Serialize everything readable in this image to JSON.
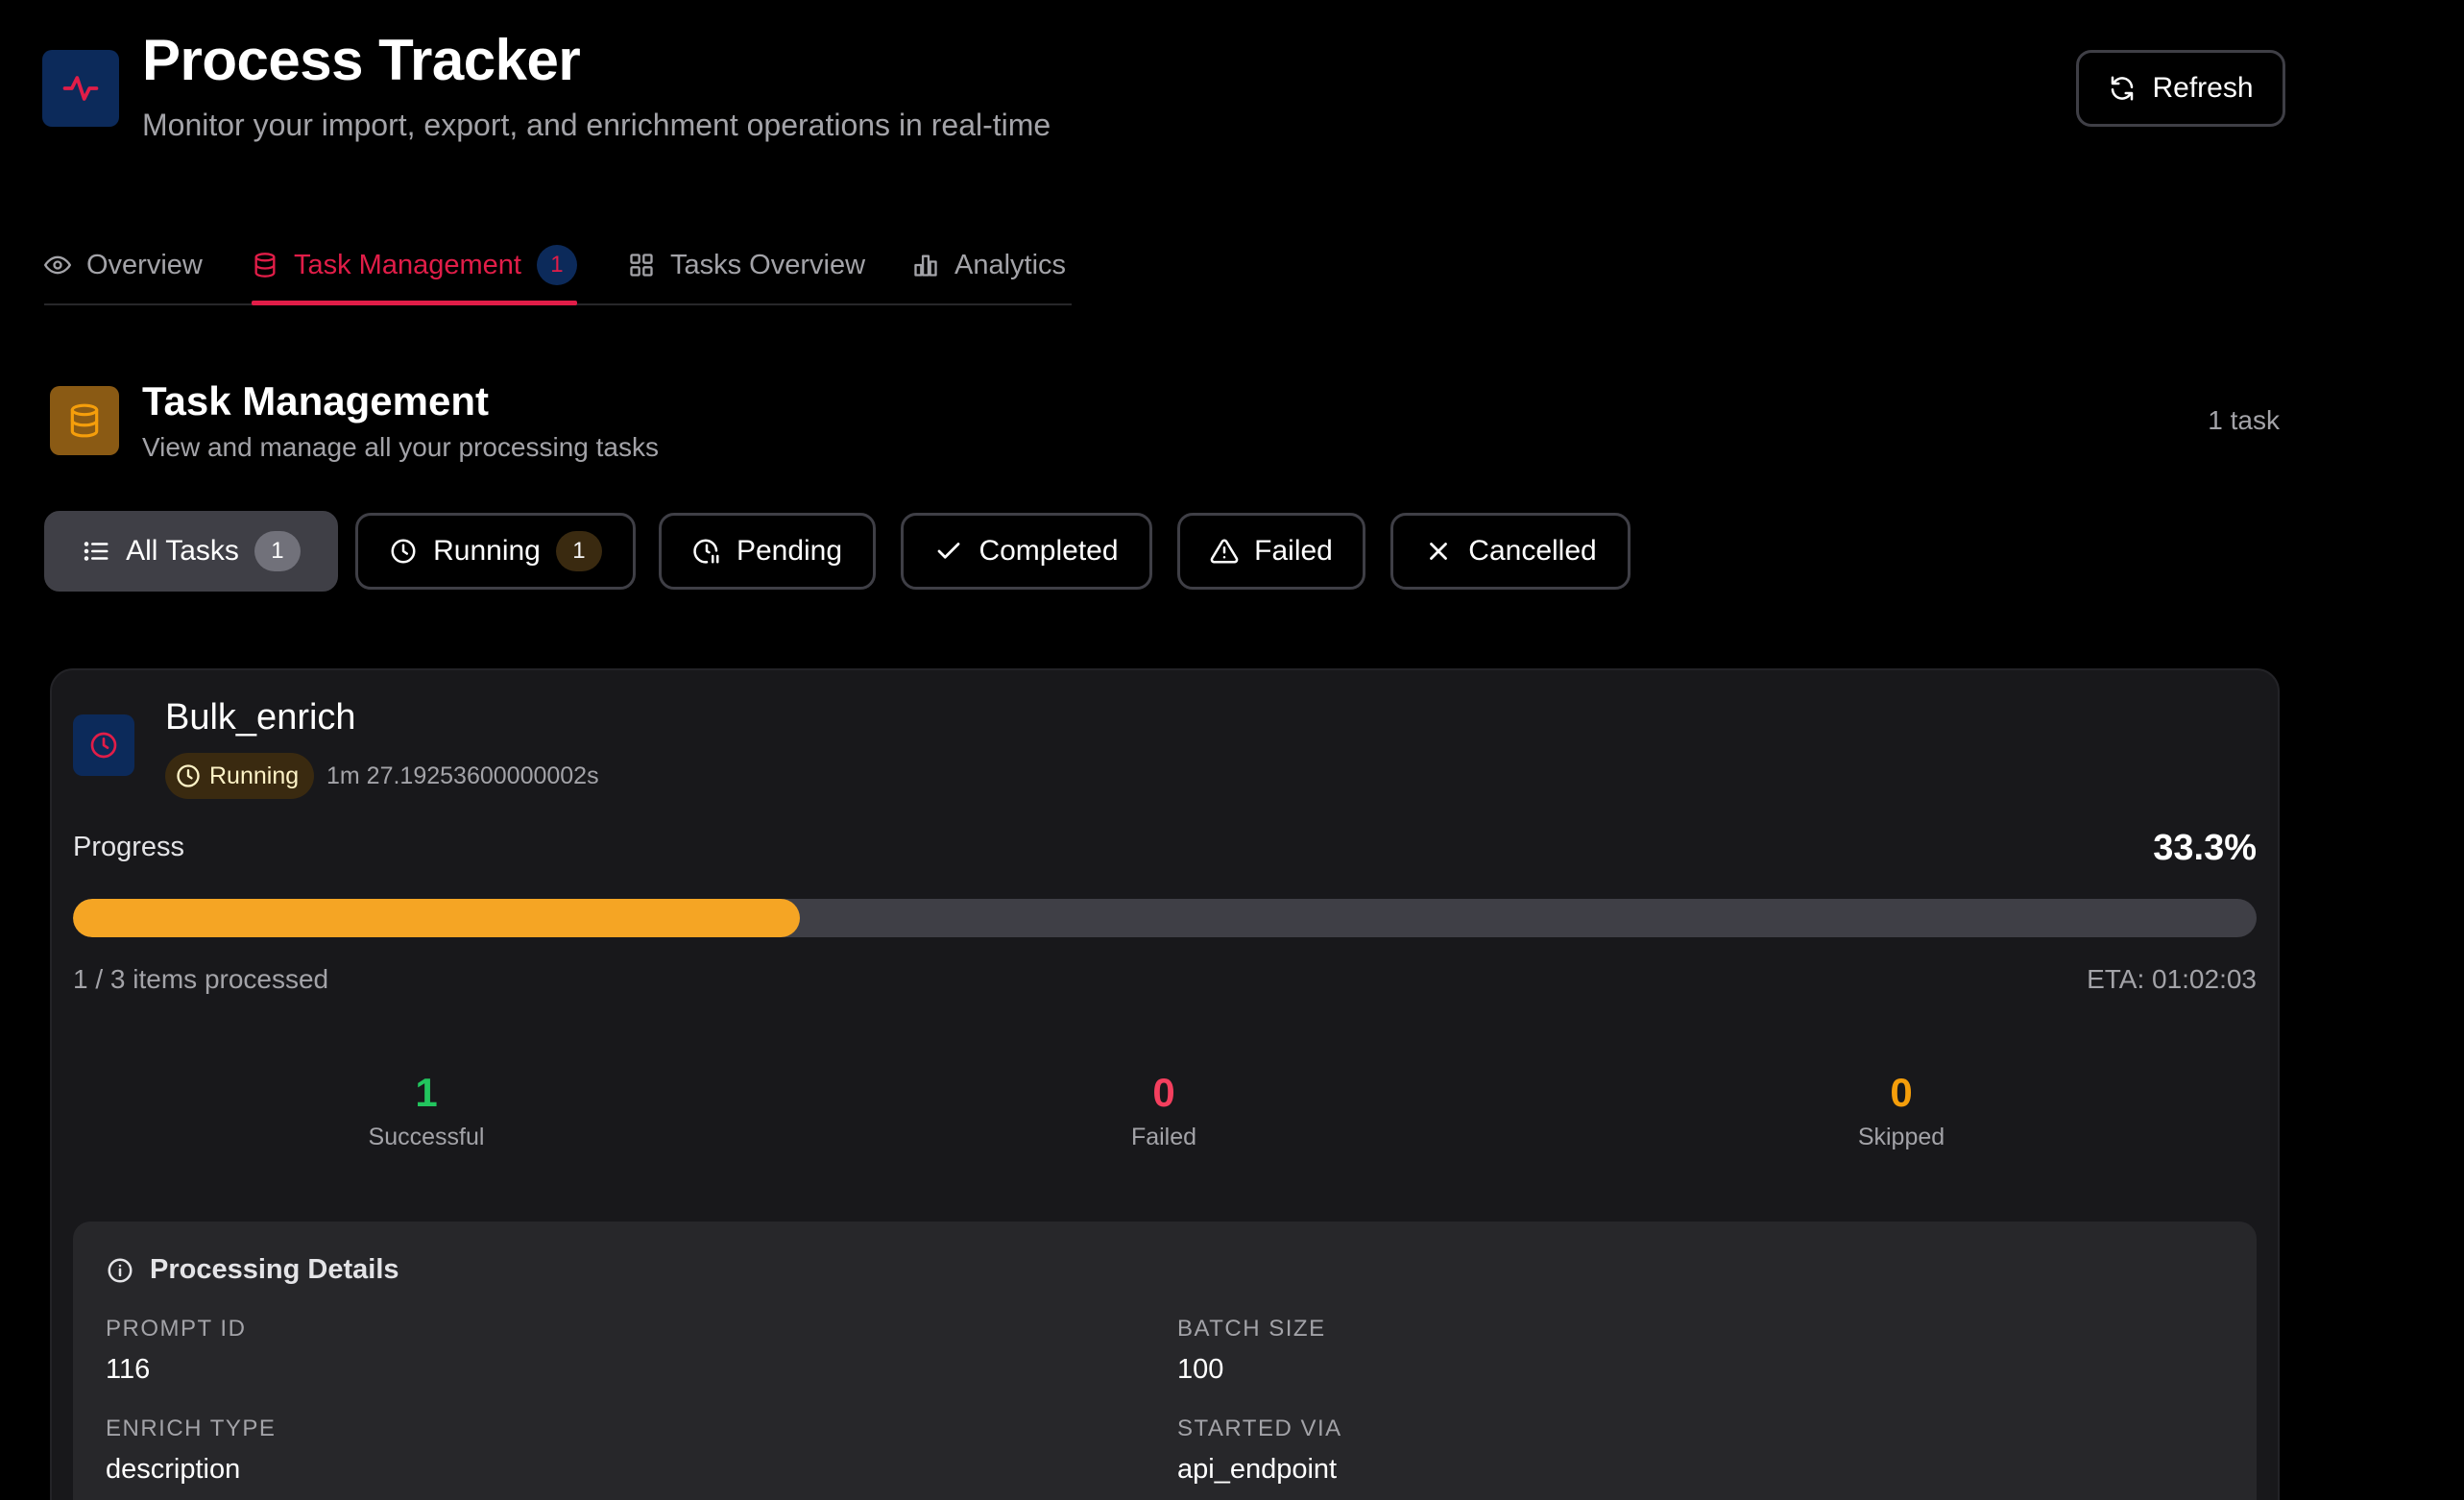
{
  "header": {
    "title": "Process Tracker",
    "subtitle": "Monitor your import, export, and enrichment operations in real-time",
    "logo_icon": "activity-icon",
    "refresh_label": "Refresh"
  },
  "tabs": [
    {
      "label": "Overview",
      "icon": "eye-icon",
      "active": false
    },
    {
      "label": "Task Management",
      "icon": "database-icon",
      "active": true,
      "badge": "1"
    },
    {
      "label": "Tasks Overview",
      "icon": "grid-icon",
      "active": false
    },
    {
      "label": "Analytics",
      "icon": "bar-chart-icon",
      "active": false
    }
  ],
  "section": {
    "title": "Task Management",
    "subtitle": "View and manage all your processing tasks",
    "count_label": "1 task",
    "icon": "database-icon"
  },
  "filters": [
    {
      "label": "All Tasks",
      "count": "1",
      "active": true,
      "icon": "list-icon"
    },
    {
      "label": "Running",
      "count": "1",
      "active": false,
      "icon": "clock-icon"
    },
    {
      "label": "Pending",
      "active": false,
      "icon": "clock-pause-icon"
    },
    {
      "label": "Completed",
      "active": false,
      "icon": "check-icon"
    },
    {
      "label": "Failed",
      "active": false,
      "icon": "alert-triangle-icon"
    },
    {
      "label": "Cancelled",
      "active": false,
      "icon": "x-icon"
    }
  ],
  "task": {
    "name": "Bulk_enrich",
    "status": "Running",
    "duration": "1m 27.19253600000002s",
    "progress_label": "Progress",
    "progress_percent_text": "33.3%",
    "progress_fraction": 0.333,
    "items_processed": "1 / 3 items processed",
    "eta": "ETA: 01:02:03",
    "stats": [
      {
        "value": "1",
        "label": "Successful",
        "color": "#22c55e"
      },
      {
        "value": "0",
        "label": "Failed",
        "color": "#f43f5e"
      },
      {
        "value": "0",
        "label": "Skipped",
        "color": "#f59e0b"
      }
    ],
    "details": {
      "title": "Processing Details",
      "fields": [
        {
          "label": "PROMPT ID",
          "value": "116"
        },
        {
          "label": "BATCH SIZE",
          "value": "100"
        },
        {
          "label": "ENRICH TYPE",
          "value": "description"
        },
        {
          "label": "STARTED VIA",
          "value": "api_endpoint"
        }
      ]
    }
  },
  "colors": {
    "accent": "#e11d48",
    "progress": "#f5a524",
    "logo_bg": "#0c2a5a",
    "section_icon_bg": "#8a5a14"
  }
}
